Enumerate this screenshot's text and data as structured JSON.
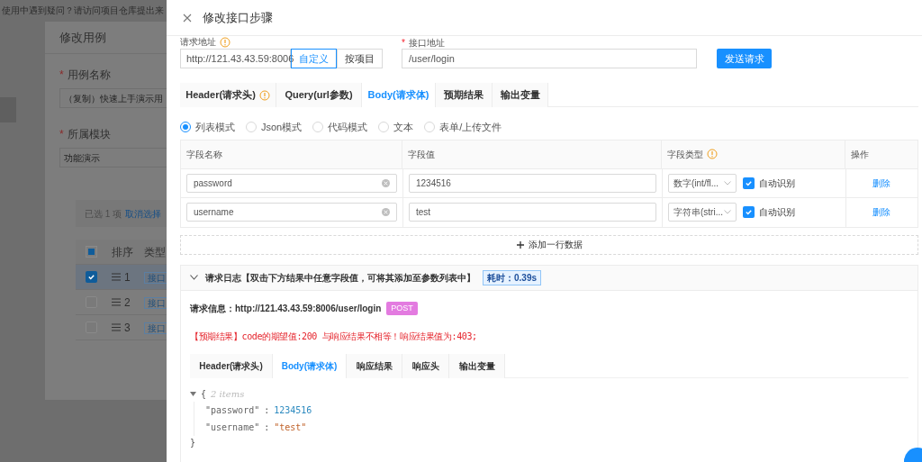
{
  "background": {
    "notice": "使用中遇到疑问？请访问项目仓库提出来",
    "modal": {
      "title": "修改用例",
      "fields": [
        {
          "label": "用例名称",
          "required_mark": "*",
          "value": "（复制）快速上手演示用"
        },
        {
          "label": "所属模块",
          "required_mark": "*",
          "value": "功能演示"
        }
      ],
      "select_all": {
        "indeterminate": true
      },
      "selection": {
        "count_text": "已选 1 项",
        "action": "取消选择"
      },
      "columns": [
        "排序",
        "类型"
      ],
      "rows": [
        {
          "order": "1",
          "type": "接口",
          "checked": true,
          "selected": true
        },
        {
          "order": "2",
          "type": "接口",
          "checked": false,
          "selected": false
        },
        {
          "order": "3",
          "type": "接口",
          "checked": false,
          "selected": false
        }
      ]
    }
  },
  "drawer": {
    "title": "修改接口步骤",
    "request_url": {
      "label": "请求地址",
      "base": "http://121.43.43.59:8006",
      "modes": [
        {
          "label": "自定义",
          "selected": true
        },
        {
          "label": "按项目",
          "selected": false
        }
      ]
    },
    "api_path": {
      "label": "接口地址",
      "required_mark": "*",
      "value": "/user/login"
    },
    "send_button": "发送请求",
    "tabs": [
      {
        "label": "Header(请求头)",
        "selected": false,
        "info": true
      },
      {
        "label": "Query(url参数)",
        "selected": false,
        "info": false
      },
      {
        "label": "Body(请求体)",
        "selected": true,
        "info": false
      },
      {
        "label": "预期结果",
        "selected": false,
        "info": false
      },
      {
        "label": "输出变量",
        "selected": false,
        "info": false
      }
    ],
    "body_modes": [
      {
        "label": "列表模式",
        "selected": true
      },
      {
        "label": "Json模式",
        "selected": false
      },
      {
        "label": "代码模式",
        "selected": false
      },
      {
        "label": "文本",
        "selected": false
      },
      {
        "label": "表单/上传文件",
        "selected": false
      }
    ],
    "table": {
      "columns": [
        "字段名称",
        "字段值",
        "字段类型",
        "操作"
      ],
      "rows": [
        {
          "name": "password",
          "value": "1234516",
          "type": "数字(int/fl...",
          "auto_detect": {
            "label": "自动识别",
            "checked": true
          },
          "action": "删除"
        },
        {
          "name": "username",
          "value": "test",
          "type": "字符串(stri...",
          "auto_detect": {
            "label": "自动识别",
            "checked": true
          },
          "action": "删除"
        }
      ]
    },
    "add_row": "添加一行数据",
    "log": {
      "title": "请求日志【双击下方结果中任意字段值，可将其添加至参数列表中】",
      "expanded": true,
      "time": "耗时：0.39s",
      "request_info": "请求信息：http://121.43.43.59:8006/user/login",
      "method": "POST",
      "error": "【预期结果】code的期望值:200 与响应结果不相等！响应结果值为:403;",
      "tabs": [
        {
          "label": "Header(请求头)",
          "selected": false
        },
        {
          "label": "Body(请求体)",
          "selected": true
        },
        {
          "label": "响应结果",
          "selected": false
        },
        {
          "label": "响应头",
          "selected": false
        },
        {
          "label": "输出变量",
          "selected": false
        }
      ],
      "json": {
        "open": "{",
        "count": "2 items",
        "entries": [
          {
            "key": "\"password\"",
            "separator": ":",
            "value": "1234516",
            "kind": "number"
          },
          {
            "key": "\"username\"",
            "separator": ":",
            "value": "\"test\"",
            "kind": "string"
          }
        ],
        "close": "}"
      }
    }
  }
}
